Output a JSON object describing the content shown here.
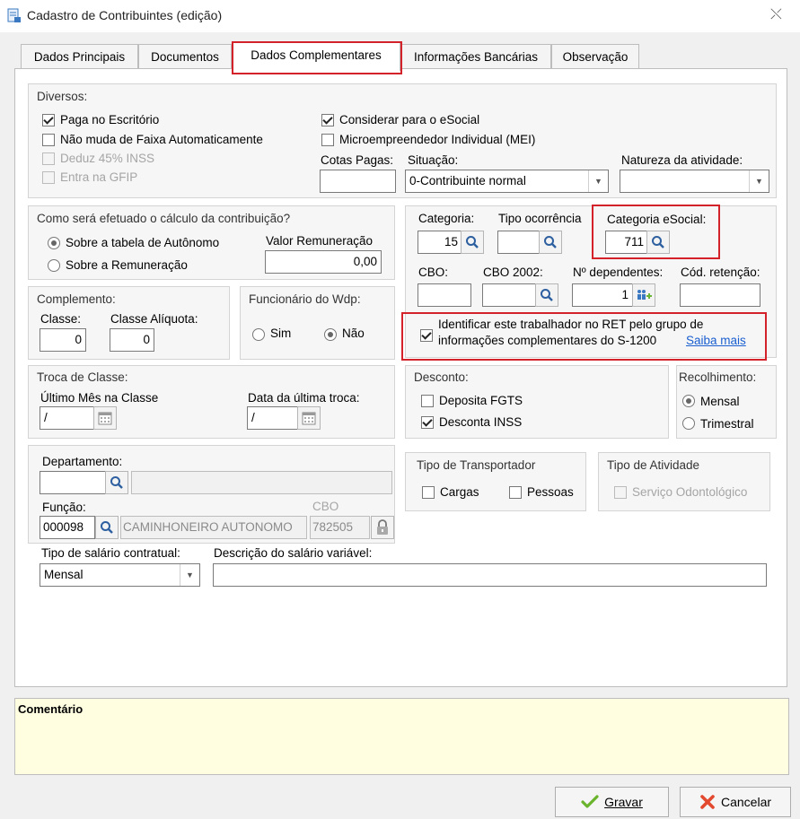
{
  "window": {
    "title": "Cadastro de Contribuintes (edição)"
  },
  "tabs": [
    {
      "label": "Dados Principais"
    },
    {
      "label": "Documentos"
    },
    {
      "label": "Dados Complementares"
    },
    {
      "label": "Informações Bancárias"
    },
    {
      "label": "Observação"
    }
  ],
  "diversos": {
    "title": "Diversos:",
    "paga_escritorio": "Paga no Escritório",
    "nao_muda_faixa": "Não muda de Faixa Automaticamente",
    "deduz_inss": "Deduz 45% INSS",
    "entra_gfip": "Entra na GFIP",
    "considerar_esocial": "Considerar para o eSocial",
    "mei": "Microempreendedor Individual (MEI)",
    "cotas_label": "Cotas Pagas:",
    "cotas_value": "",
    "situacao_label": "Situação:",
    "situacao_value": "0-Contribuinte normal",
    "natureza_label": "Natureza da atividade:",
    "natureza_value": ""
  },
  "calculo": {
    "title": "Como será efetuado o cálculo da contribuição?",
    "opt_autonomo": "Sobre a tabela de Autônomo",
    "opt_remuneracao": "Sobre a Remuneração",
    "valor_label": "Valor Remuneração",
    "valor_value": "0,00"
  },
  "categoria": {
    "categoria_label": "Categoria:",
    "categoria_value": "15",
    "tipo_ocorrencia_label": "Tipo ocorrência",
    "tipo_ocorrencia_value": "",
    "categoria_esocial_label": "Categoria eSocial:",
    "categoria_esocial_value": "711",
    "cbo_label": "CBO:",
    "cbo_value": "",
    "cbo2002_label": "CBO 2002:",
    "cbo2002_value": "",
    "dependentes_label": "Nº dependentes:",
    "dependentes_value": "1",
    "retencao_label": "Cód. retenção:",
    "retencao_value": "",
    "ret_line1": "Identificar este trabalhador no RET pelo grupo de",
    "ret_line2": "informações complementares do S-1200",
    "saiba_mais": "Saiba mais"
  },
  "complemento": {
    "title": "Complemento:",
    "classe_label": "Classe:",
    "classe_value": "0",
    "aliquota_label": "Classe Alíquota:",
    "aliquota_value": "0"
  },
  "funcionario": {
    "title": "Funcionário do Wdp:",
    "sim": "Sim",
    "nao": "Não"
  },
  "troca": {
    "title": "Troca de Classe:",
    "ultimo_label": "Último Mês na Classe",
    "ultimo_value": "/",
    "data_label": "Data da última troca:",
    "data_value": "/"
  },
  "desconto": {
    "title": "Desconto:",
    "fgts": "Deposita FGTS",
    "inss": "Desconta INSS"
  },
  "recolhimento": {
    "title": "Recolhimento:",
    "mensal": "Mensal",
    "trimestral": "Trimestral"
  },
  "lotacao": {
    "departamento_label": "Departamento:",
    "departamento_code": "",
    "departamento_name": "",
    "funcao_label": "Função:",
    "funcao_code": "000098",
    "funcao_name": "CAMINHONEIRO AUTONOMO",
    "cbo_label": "CBO",
    "cbo_value": "782505",
    "tipo_salario_label": "Tipo de salário contratual:",
    "tipo_salario_value": "Mensal",
    "descricao_label": "Descrição do salário variável:",
    "descricao_value": ""
  },
  "transportador": {
    "title": "Tipo de Transportador",
    "cargas": "Cargas",
    "pessoas": "Pessoas"
  },
  "atividade": {
    "title": "Tipo de Atividade",
    "odonto": "Serviço Odontológico"
  },
  "comentario": {
    "label": "Comentário"
  },
  "buttons": {
    "gravar": "Gravar",
    "cancelar": "Cancelar"
  }
}
